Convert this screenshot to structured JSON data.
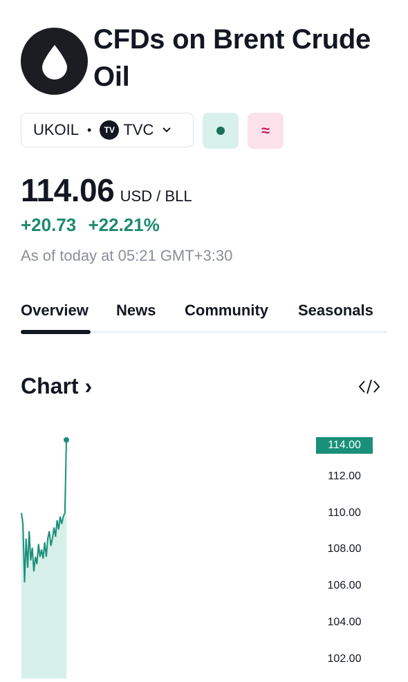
{
  "header": {
    "title": "CFDs on Brent Crude Oil",
    "logo_icon": "oil-drop-icon"
  },
  "symbol": {
    "ticker": "UKOIL",
    "separator": "•",
    "exchange_logo_text": "TV",
    "exchange": "TVC",
    "market_status_color": "#16725a",
    "extra_badge": "≈"
  },
  "quote": {
    "price": "114.06",
    "currency": "USD / BLL",
    "change_abs": "+20.73",
    "change_pct": "+22.21%",
    "as_of": "As of today at 05:21 GMT+3:30"
  },
  "tabs": [
    {
      "label": "Overview",
      "active": true
    },
    {
      "label": "News",
      "active": false
    },
    {
      "label": "Community",
      "active": false
    },
    {
      "label": "Seasonals",
      "active": false
    }
  ],
  "chart_section": {
    "title": "Chart",
    "arrow": "›",
    "embed_icon": "code-embed-icon"
  },
  "chart_data": {
    "type": "area",
    "current_label": "114.00",
    "y_ticks": [
      "114.00",
      "112.00",
      "110.00",
      "108.00",
      "106.00",
      "104.00",
      "102.00"
    ],
    "ylim": [
      101.2,
      114.4
    ],
    "line_color": "#1a9079",
    "fill_color": "#d6efe9",
    "series": [
      {
        "values": [
          110.0,
          109.4,
          106.2,
          108.6,
          107.0,
          109.0,
          107.4,
          108.1,
          106.8,
          107.6,
          107.2,
          108.3,
          107.6,
          108.0,
          107.5,
          108.4,
          107.6,
          108.6,
          109.0,
          108.2,
          108.6,
          109.2,
          108.7,
          109.6,
          109.1,
          109.8,
          109.4,
          109.8,
          110.0,
          114.0
        ]
      }
    ]
  }
}
